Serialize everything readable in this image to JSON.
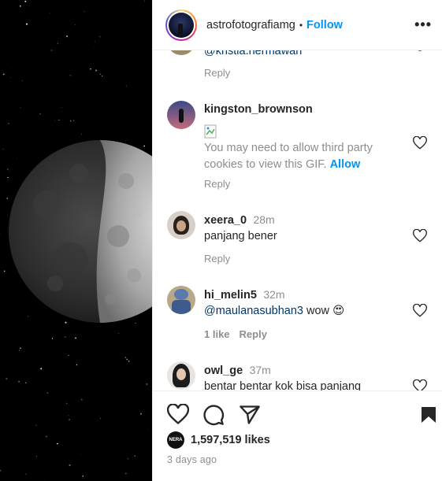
{
  "header": {
    "username": "astrofotografiamg",
    "separator": "•",
    "follow_label": "Follow",
    "more_label": "•••"
  },
  "comments": [
    {
      "username": "@kristia.hermawan",
      "reply_label": "Reply"
    },
    {
      "username": "kingston_brownson",
      "text_main": "You may need to allow third party cookies to view this GIF.",
      "allow_label": "Allow",
      "reply_label": "Reply"
    },
    {
      "username": "xeera_0",
      "time": "28m",
      "text": "panjang bener",
      "reply_label": "Reply"
    },
    {
      "username": "hi_melin5",
      "time": "32m",
      "mention": "@maulanasubhan3",
      "text": "wow",
      "emoji": "😍",
      "likes_label": "1 like",
      "reply_label": "Reply"
    },
    {
      "username": "owl_ge",
      "time": "37m",
      "text": "bentar bentar kok bisa panjang"
    }
  ],
  "actions": {
    "like_icon": "heart-icon",
    "comment_icon": "comment-icon",
    "share_icon": "share-icon",
    "save_icon": "bookmark-icon"
  },
  "likes": {
    "avatar_text": "NERA",
    "count_text": "1,597,519 likes"
  },
  "post_date": "3 days ago",
  "colors": {
    "accent": "#0095f6",
    "muted": "#8e8e8e",
    "text": "#262626"
  }
}
